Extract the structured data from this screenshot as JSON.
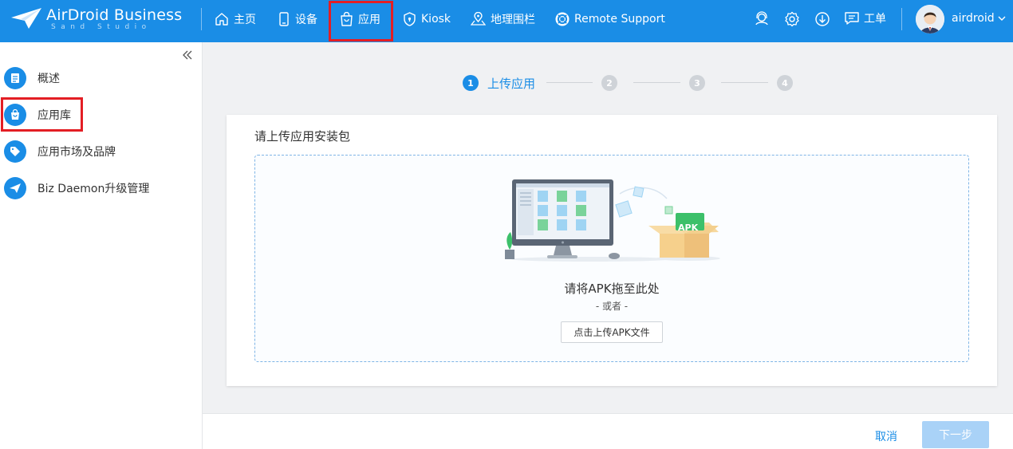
{
  "brand": {
    "name": "AirDroid Business",
    "sub": "Sand Studio"
  },
  "nav": {
    "home": "主页",
    "devices": "设备",
    "apps": "应用",
    "kiosk": "Kiosk",
    "geofence": "地理围栏",
    "remote_support": "Remote Support",
    "work_order": "工单",
    "username": "airdroid",
    "active_item": "应用"
  },
  "sidebar": {
    "items": [
      {
        "label": "概述",
        "icon": "document-icon"
      },
      {
        "label": "应用库",
        "icon": "shopping-bag-icon"
      },
      {
        "label": "应用市场及品牌",
        "icon": "tag-icon"
      },
      {
        "label": "Biz Daemon升级管理",
        "icon": "paper-plane-icon"
      }
    ],
    "active_item": "应用库"
  },
  "steps": {
    "current": 1,
    "items": [
      {
        "number": "1",
        "label": "上传应用"
      },
      {
        "number": "2",
        "label": ""
      },
      {
        "number": "3",
        "label": ""
      },
      {
        "number": "4",
        "label": ""
      }
    ]
  },
  "upload": {
    "title": "请上传应用安装包",
    "drop_hint": "请将APK拖至此处",
    "or_text": "- 或者 -",
    "button_label": "点击上传APK文件",
    "apk_label": "APK"
  },
  "footer": {
    "cancel_label": "取消",
    "next_label": "下一步"
  },
  "colors": {
    "primary": "#1a8de6",
    "highlight_box": "#e31e24",
    "next_disabled": "#a9d2f7",
    "apk_green": "#3cc06a"
  }
}
